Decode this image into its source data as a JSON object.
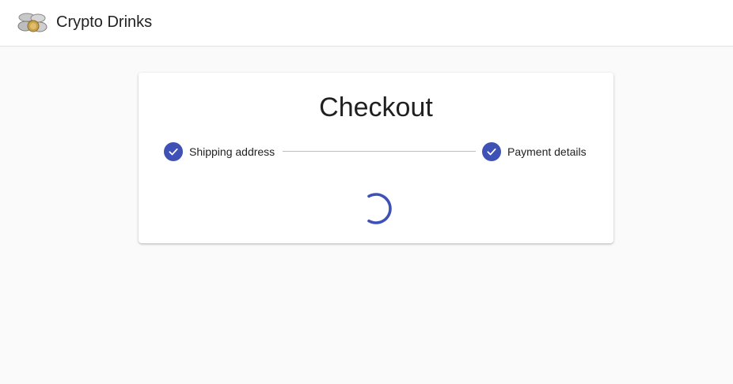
{
  "app": {
    "brand": "Crypto Drinks",
    "logo_icon": "coins-logo-icon"
  },
  "checkout": {
    "title": "Checkout",
    "steps": [
      {
        "label": "Shipping address",
        "status": "completed",
        "icon": "check-icon"
      },
      {
        "label": "Payment details",
        "status": "completed",
        "icon": "check-icon"
      }
    ],
    "loading": true
  },
  "colors": {
    "accent": "#3f51b5",
    "background": "#fafafa",
    "surface": "#ffffff",
    "connector": "#bdbdbd"
  }
}
